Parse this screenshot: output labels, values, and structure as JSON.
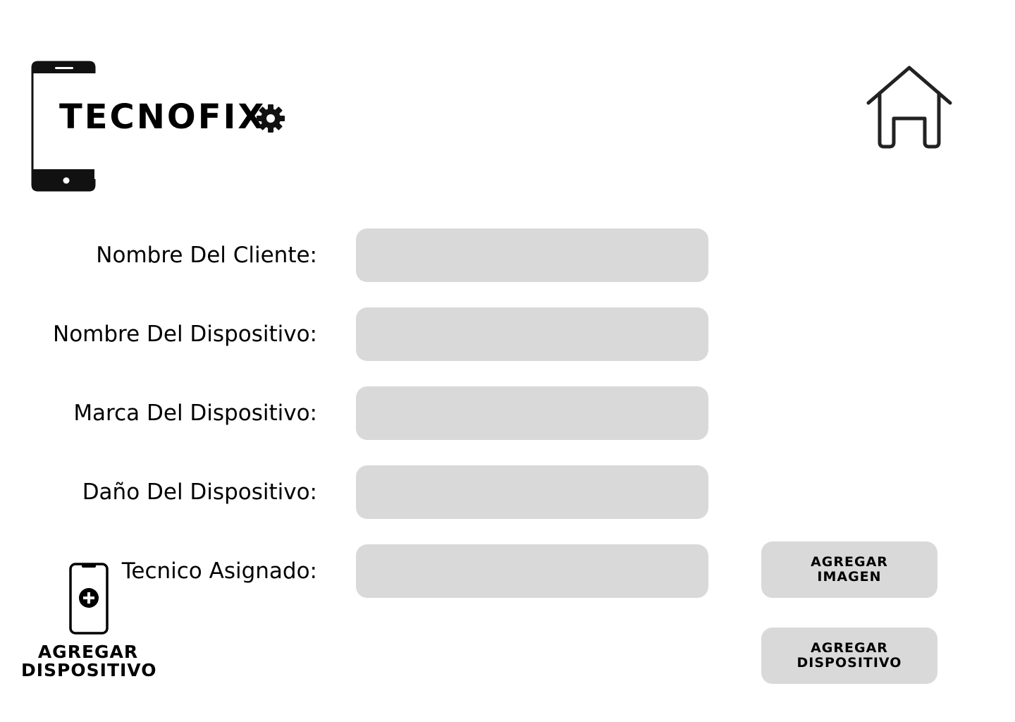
{
  "brand": {
    "name": "TECNOFIX"
  },
  "icons": {
    "logo_phone": "smartphone-icon",
    "logo_gear": "gear-icon",
    "home": "home-icon",
    "add_device_phone": "smartphone-add-icon"
  },
  "form": {
    "fields": [
      {
        "label": "Nombre Del Cliente:",
        "value": "",
        "placeholder": ""
      },
      {
        "label": "Nombre Del Dispositivo:",
        "value": "",
        "placeholder": ""
      },
      {
        "label": "Marca Del Dispositivo:",
        "value": "",
        "placeholder": ""
      },
      {
        "label": "Daño Del Dispositivo:",
        "value": "",
        "placeholder": ""
      },
      {
        "label": "Tecnico Asignado:",
        "value": "",
        "placeholder": ""
      }
    ]
  },
  "actions": {
    "add_image": {
      "line1": "AGREGAR",
      "line2": "IMAGEN"
    },
    "add_device": {
      "line1": "AGREGAR",
      "line2": "DISPOSITIVO"
    }
  },
  "add_device_widget": {
    "line1": "AGREGAR",
    "line2": "DISPOSITIVO"
  },
  "colors": {
    "background": "#ffffff",
    "field_fill": "#d9d9d9",
    "text": "#000000",
    "icon_stroke": "#222222"
  }
}
